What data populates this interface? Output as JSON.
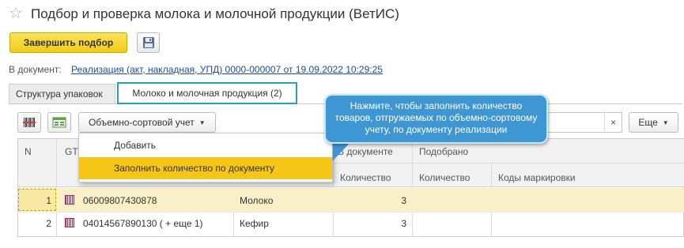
{
  "header": {
    "title": "Подбор и проверка молока и молочной продукции (ВетИС)"
  },
  "toolbar": {
    "finish_label": "Завершить подбор"
  },
  "document": {
    "label": "В документ:",
    "link": "Реализация (акт, накладная, УПД) 0000-000007 от 19.09.2022 10:29:25"
  },
  "tabs": [
    {
      "label": "Структура упаковок",
      "active": false
    },
    {
      "label": "Молоко и молочная продукция (2)",
      "active": true
    }
  ],
  "list_toolbar": {
    "mode_dropdown": "Объемно-сортовой учет",
    "search_value": "",
    "clear_icon": "×",
    "more_label": "Еще"
  },
  "dropdown_menu": {
    "items": [
      {
        "label": "Добавить",
        "highlighted": false
      },
      {
        "label": "Заполнить количество по документу",
        "highlighted": true
      }
    ]
  },
  "callout": {
    "text": "Нажмите, чтобы заполнить количество товаров, отгружаемых по объемно-сортовому учету, по документу реализации"
  },
  "table": {
    "columns": {
      "n": "N",
      "gtin": "GT",
      "in_doc_group": "В документе",
      "in_doc_qty": "Количество",
      "picked_group": "Подобрано",
      "picked_qty": "Количество",
      "codes": "Коды маркировки"
    },
    "rows": [
      {
        "n": "1",
        "gtin": "06009807430878",
        "name": "Молоко",
        "doc_qty": "3",
        "picked_qty": "",
        "codes": "",
        "selected": true
      },
      {
        "n": "2",
        "gtin": "04014567890130 ( + еще 1)",
        "name": "Кефир",
        "doc_qty": "3",
        "picked_qty": "",
        "codes": "",
        "selected": false
      }
    ]
  },
  "colors": {
    "accent_yellow": "#f5c617",
    "tab_highlight": "#2aa1b3",
    "callout_blue": "#3e97d2",
    "link_blue": "#1e4e9a",
    "selected_row": "#faf0c8"
  },
  "icons": [
    "star-icon",
    "save-icon",
    "barcode-scan-icon",
    "fill-table-icon",
    "dropdown-caret-icon",
    "clear-icon",
    "barcode-icon"
  ]
}
